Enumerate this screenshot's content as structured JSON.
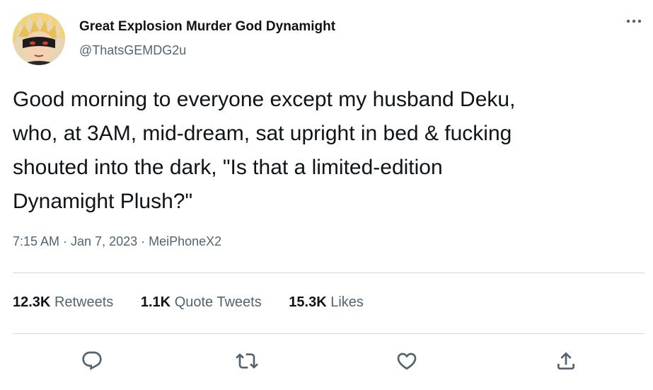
{
  "author": {
    "display_name": "Great Explosion Murder God Dynamight",
    "handle": "@ThatsGEMDG2u",
    "avatar_icon": "avatar-anime-character"
  },
  "tweet": {
    "text": "Good morning to everyone except my husband Deku,\nwho, at 3AM, mid-dream, sat upright in bed & fucking\nshouted into the dark, \"Is that a limited-edition\nDynamight Plush?\"",
    "time": "7:15 AM",
    "date": "Jan 7, 2023",
    "source": "MeiPhoneX2",
    "separator": "·"
  },
  "stats": {
    "retweets": {
      "count": "12.3K",
      "label": "Retweets"
    },
    "quote_tweets": {
      "count": "1.1K",
      "label": "Quote Tweets"
    },
    "likes": {
      "count": "15.3K",
      "label": "Likes"
    }
  },
  "actions": [
    "reply-icon",
    "retweet-icon",
    "like-icon",
    "share-icon"
  ],
  "colors": {
    "text": "#0f1419",
    "secondary": "#536471",
    "divider": "#cfd9de"
  }
}
